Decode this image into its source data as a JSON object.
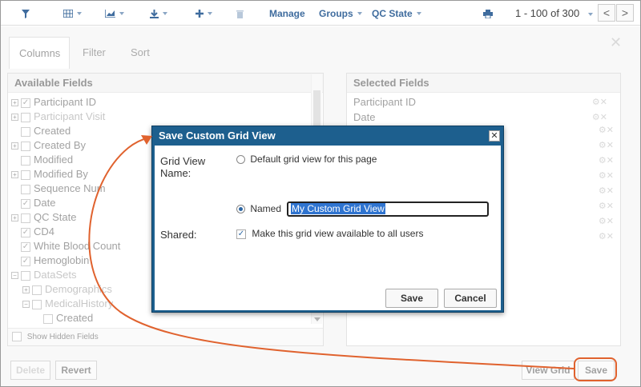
{
  "toolbar": {
    "manage": "Manage",
    "groups": "Groups",
    "qc_state": "QC State",
    "pager": "1 - 100 of 300",
    "prev": "<",
    "next": ">"
  },
  "panel": {
    "tabs": [
      "Columns",
      "Filter",
      "Sort"
    ],
    "available_title": "Available Fields",
    "selected_title": "Selected Fields",
    "available_fields": [
      {
        "label": "Participant ID",
        "checked": true,
        "expand": true,
        "indent": 0,
        "dim": false
      },
      {
        "label": "Participant Visit",
        "checked": false,
        "expand": true,
        "indent": 0,
        "dim": true
      },
      {
        "label": "Created",
        "checked": false,
        "expand": false,
        "indent": 0,
        "dim": false
      },
      {
        "label": "Created By",
        "checked": false,
        "expand": true,
        "indent": 0,
        "dim": false
      },
      {
        "label": "Modified",
        "checked": false,
        "expand": false,
        "indent": 0,
        "dim": false
      },
      {
        "label": "Modified By",
        "checked": false,
        "expand": true,
        "indent": 0,
        "dim": false
      },
      {
        "label": "Sequence Num",
        "checked": false,
        "expand": false,
        "indent": 0,
        "dim": false
      },
      {
        "label": "Date",
        "checked": true,
        "expand": false,
        "indent": 0,
        "dim": false
      },
      {
        "label": "QC State",
        "checked": false,
        "expand": true,
        "indent": 0,
        "dim": false
      },
      {
        "label": "CD4",
        "checked": true,
        "expand": false,
        "indent": 0,
        "dim": false
      },
      {
        "label": "White Blood Count",
        "checked": true,
        "expand": false,
        "indent": 0,
        "dim": false
      },
      {
        "label": "Hemoglobin",
        "checked": true,
        "expand": false,
        "indent": 0,
        "dim": false
      },
      {
        "label": "DataSets",
        "checked": false,
        "expand": "minus",
        "indent": 0,
        "dim": true
      },
      {
        "label": "Demographics",
        "checked": false,
        "expand": true,
        "indent": 1,
        "dim": true
      },
      {
        "label": "MedicalHistory",
        "checked": false,
        "expand": "minus",
        "indent": 1,
        "dim": true
      },
      {
        "label": "Created",
        "checked": false,
        "expand": false,
        "indent": 2,
        "dim": false
      }
    ],
    "selected_fields": [
      "Participant ID",
      "Date"
    ],
    "show_hidden": "Show Hidden Fields",
    "delete": "Delete",
    "revert": "Revert",
    "view_grid": "View Grid",
    "save": "Save"
  },
  "dialog": {
    "title": "Save Custom Grid View",
    "grid_view_name_label": "Grid View Name:",
    "default_option": "Default grid view for this page",
    "named_option": "Named",
    "named_value": "My Custom Grid View",
    "shared_label": "Shared:",
    "shared_option": "Make this grid view available to all users",
    "save": "Save",
    "cancel": "Cancel"
  },
  "colors": {
    "accent": "#3f6c9e",
    "dialog_header": "#1d5f8e",
    "annotation": "#e0622e",
    "selection": "#2f74d0"
  }
}
